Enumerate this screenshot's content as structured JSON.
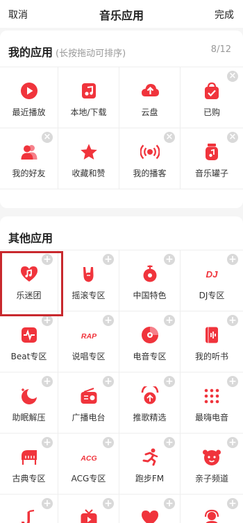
{
  "header": {
    "cancel": "取消",
    "title": "音乐应用",
    "done": "完成"
  },
  "mine": {
    "title": "我的应用",
    "subtitle": "(长按拖动可排序)",
    "count": "8/12",
    "items": [
      {
        "label": "最近播放",
        "icon": "play-circle-icon",
        "removable": false
      },
      {
        "label": "本地/下载",
        "icon": "music-file-icon",
        "removable": false
      },
      {
        "label": "云盘",
        "icon": "cloud-upload-icon",
        "removable": false
      },
      {
        "label": "已购",
        "icon": "shopping-bag-icon",
        "removable": true
      },
      {
        "label": "我的好友",
        "icon": "friends-icon",
        "removable": true
      },
      {
        "label": "收藏和赞",
        "icon": "star-icon",
        "removable": false
      },
      {
        "label": "我的播客",
        "icon": "podcast-icon",
        "removable": true
      },
      {
        "label": "音乐罐子",
        "icon": "music-jar-icon",
        "removable": true
      }
    ]
  },
  "other": {
    "title": "其他应用",
    "items": [
      {
        "label": "乐迷团",
        "icon": "fan-club-heart-icon"
      },
      {
        "label": "摇滚专区",
        "icon": "rock-hand-icon"
      },
      {
        "label": "中国特色",
        "icon": "chinese-style-icon"
      },
      {
        "label": "DJ专区",
        "icon": "dj-icon"
      },
      {
        "label": "Beat专区",
        "icon": "beat-icon"
      },
      {
        "label": "说唱专区",
        "icon": "rap-icon"
      },
      {
        "label": "电音专区",
        "icon": "electronic-disc-icon"
      },
      {
        "label": "我的听书",
        "icon": "audiobook-icon"
      },
      {
        "label": "助眠解压",
        "icon": "sleep-moon-icon"
      },
      {
        "label": "广播电台",
        "icon": "radio-icon"
      },
      {
        "label": "推歌精选",
        "icon": "song-recommend-icon"
      },
      {
        "label": "最嗨电音",
        "icon": "dot-matrix-icon"
      },
      {
        "label": "古典专区",
        "icon": "piano-icon"
      },
      {
        "label": "ACG专区",
        "icon": "acg-icon"
      },
      {
        "label": "跑步FM",
        "icon": "running-icon"
      },
      {
        "label": "亲子频道",
        "icon": "kids-face-icon"
      },
      {
        "label": "",
        "icon": "saxophone-icon"
      },
      {
        "label": "",
        "icon": "tv-icon"
      },
      {
        "label": "",
        "icon": "heart-icon"
      },
      {
        "label": "",
        "icon": "headset-person-icon"
      }
    ]
  },
  "icon_glyphs": {
    "dj-icon": "DJ",
    "rap-icon": "RAP",
    "acg-icon": "ACG"
  },
  "colors": {
    "accent": "#f0343c",
    "highlight": "#c8282d",
    "badge": "#d9d9d9"
  },
  "badge_glyphs": {
    "add": "+",
    "remove": "×"
  }
}
